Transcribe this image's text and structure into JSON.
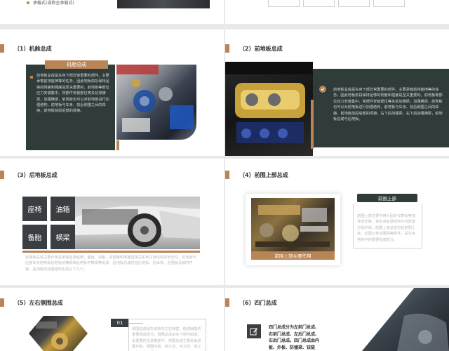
{
  "colors": {
    "accent": "#b98456",
    "dark_panel": "#2f3c3a",
    "tile": "#3a3d42",
    "body_text": "#bcbcbc"
  },
  "top_partial": {
    "bullet_text": "承载式(或称全承载式)"
  },
  "slide_engine": {
    "number": "（1）",
    "title": "机舱总成",
    "header_label": "机舱总成",
    "body": "前地板总成是车身下部非常重要的部件。主要承载前排座椅等的任务，因此地板前段保持足够的刚度和强度是至关重要的。前地板等部位应力安装集中。常部件安装部位等多处加横梁，加强横梁，前地板也可以对前地板进行加强结构，前地板与车身、前后侧围之间的焊接，前地板前段后部的焊接。"
  },
  "slide_front_floor": {
    "number": "（2）",
    "title": "前地板总成",
    "check_icon": "check-circle-icon",
    "body": "前地板总成是车身下部非常重要的部件。主要承载前排座椅等的任务，因此地板前段保持足够的刚度和强度是至关重要的。前地板等部位应力安装集中。常部件安装部位等多处加横梁，加强横梁，前地板也可以对前地板进行加强结构，前地板与车身、前后侧围之间的焊接，前地板前段后部的焊接，右下后加强梁，右下后加强横梁，前地板总成与后地板。"
  },
  "slide_rear_floor": {
    "number": "（3）",
    "title": "后地板总成",
    "tiles": [
      "座椅",
      "油箱",
      "备胎",
      "横梁"
    ],
    "body": "后地板总成主要作用是承载后排座椅、备胎、油箱，其强度和刚度直接关系到车身结构的安全性，后地板与后部车身结构由后地板前横梁和后地板中横梁等组成，后地板总成包括后地板、后纵梁、后围板及其附件等，后地板的加强结构也有以下几个。"
  },
  "slide_front_upper": {
    "number": "（4）",
    "title": "前围上部总成",
    "caption": "前围上部主要作用",
    "tag": "前围上部",
    "body": "前围上部主要作用为固定仪表板等部件的安装，将车身前部结构与驾驶室分隔开来，前围上部总成包括前围上板、前围上板加强梁等部件，是车身结构中的重要组成部分。"
  },
  "slide_side": {
    "number": "（5）",
    "title": "左右侧围总成",
    "tag": "01",
    "body": "侧围总成是形成轿车左右侧壁，结成厢框的重要组成部分，侧围总成由多个部件组成，是重要的主承载部件；侧围总成主要是由侧围外板、侧围内板、前立柱、中立柱、后立柱等结构件组成。"
  },
  "slide_doors": {
    "number": "（6）",
    "title": "四门总成",
    "icon": "edit-icon",
    "body": "四门总成分为左前门总成、右前门总成、左后门总成、右后门总成。四门总成由内板、外板、防撞梁、铰链"
  }
}
